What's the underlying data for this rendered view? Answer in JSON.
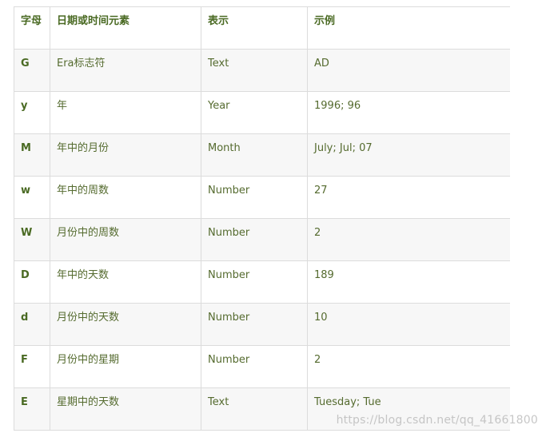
{
  "table": {
    "headers": [
      "字母",
      "日期或时间元素",
      "表示",
      "示例"
    ],
    "rows": [
      {
        "letter": "G",
        "element": "Era标志符",
        "presentation": "Text",
        "example": "AD"
      },
      {
        "letter": "y",
        "element": "年",
        "presentation": "Year",
        "example": "1996; 96"
      },
      {
        "letter": "M",
        "element": "年中的月份",
        "presentation": "Month",
        "example": "July; Jul; 07"
      },
      {
        "letter": "w",
        "element": "年中的周数",
        "presentation": "Number",
        "example": "27"
      },
      {
        "letter": "W",
        "element": "月份中的周数",
        "presentation": "Number",
        "example": "2"
      },
      {
        "letter": "D",
        "element": "年中的天数",
        "presentation": "Number",
        "example": "189"
      },
      {
        "letter": "d",
        "element": "月份中的天数",
        "presentation": "Number",
        "example": "10"
      },
      {
        "letter": "F",
        "element": "月份中的星期",
        "presentation": "Number",
        "example": "2"
      },
      {
        "letter": "E",
        "element": "星期中的天数",
        "presentation": "Text",
        "example": "Tuesday; Tue"
      }
    ]
  },
  "watermark": "https://blog.csdn.net/qq_41661800",
  "colors": {
    "text": "#556b2f",
    "border": "#dcdcdc",
    "stripe": "#f7f7f7"
  }
}
